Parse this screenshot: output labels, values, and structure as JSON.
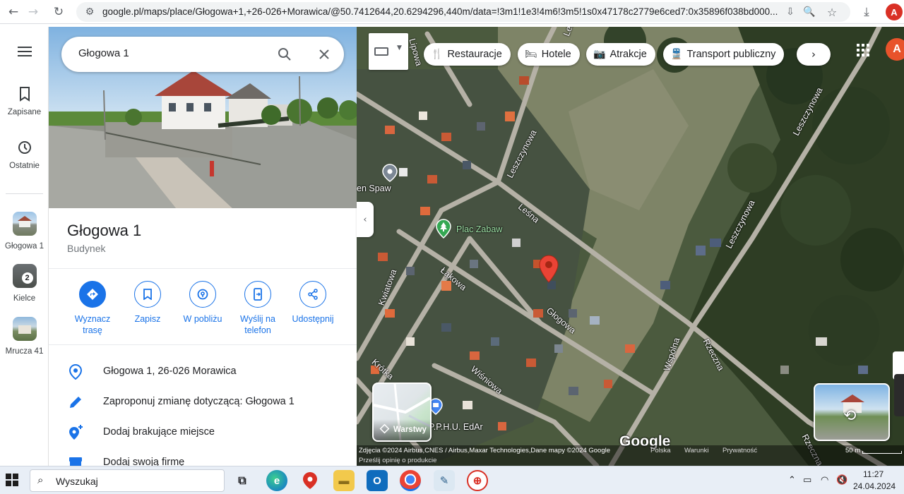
{
  "browser": {
    "url": "google.pl/maps/place/Głogowa+1,+26-026+Morawica/@50.7412644,20.6294296,440m/data=!3m1!1e3!4m6!3m5!1s0x47178c2779e6ced7:0x35896f038bd000...",
    "profile_initial": "A"
  },
  "rail": {
    "saved_label": "Zapisane",
    "recent_label": "Ostatnie",
    "history": [
      {
        "label": "Głogowa 1",
        "badge": ""
      },
      {
        "label": "Kielce",
        "badge": "2"
      },
      {
        "label": "Mrucza 41",
        "badge": ""
      }
    ]
  },
  "search": {
    "value": "Głogowa 1"
  },
  "place": {
    "title": "Głogowa 1",
    "subtitle": "Budynek",
    "actions": [
      {
        "label": "Wyznacz trasę"
      },
      {
        "label": "Zapisz"
      },
      {
        "label": "W pobliżu"
      },
      {
        "label": "Wyślij na telefon"
      },
      {
        "label": "Udostępnij"
      }
    ],
    "info": [
      {
        "text": "Głogowa 1, 26-026 Morawica"
      },
      {
        "text": "Zaproponuj zmianę dotyczącą: Głogowa 1"
      },
      {
        "text": "Dodaj brakujące miejsce"
      },
      {
        "text": "Dodaj swoją firmę"
      }
    ]
  },
  "map": {
    "chips": [
      "Restauracje",
      "Hotele",
      "Atrakcje",
      "Transport publiczny"
    ],
    "streets": [
      "Lipowa",
      "Leszczynowa",
      "Leśna",
      "Leszczynowa",
      "Leszczynowa",
      "Leszczynowa",
      "Kwiatowa",
      "Łąkowa",
      "Głogowa",
      "Wspólna",
      "Rzeczna",
      "Krótka",
      "Wiśniowa",
      "Rzeczna"
    ],
    "pois": {
      "playground": "Plac Zabaw",
      "business": "P.P.H.U. EdAr",
      "partial": "en Spaw"
    },
    "layers_label": "Warstwy",
    "google_logo": "Google",
    "attribution": "Zdjęcia ©2024 Airbus,CNES / Airbus,Maxar Technologies,Dane mapy ©2024 Google",
    "footer_links": [
      "Polska",
      "Warunki",
      "Prywatność"
    ],
    "feedback": "Prześlij opinię o produkcie",
    "scale": "50 m"
  },
  "taskbar": {
    "search_placeholder": "Wyszukaj",
    "time": "11:27",
    "date": "24.04.2024"
  },
  "colors": {
    "accent": "#1a73e8",
    "pin": "#ea4335",
    "playground": "#34a853"
  }
}
